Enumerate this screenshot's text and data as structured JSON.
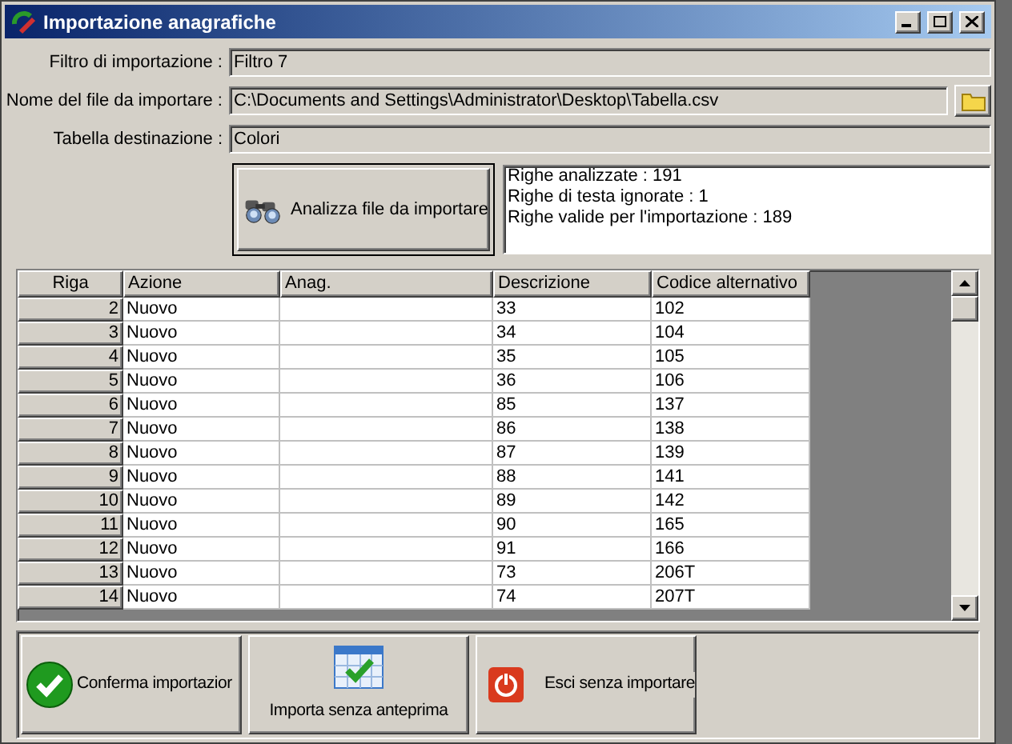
{
  "window": {
    "title": "Importazione anagrafiche"
  },
  "fields": [
    {
      "label": "Filtro di importazione :",
      "value": "Filtro 7",
      "kind": "text"
    },
    {
      "label": "Nome del file da importare :",
      "value": "C:\\Documents and Settings\\Administrator\\Desktop\\Tabella.csv",
      "kind": "file"
    },
    {
      "label": "Tabella destinazione :",
      "value": "Colori",
      "kind": "text"
    }
  ],
  "analyze_button": {
    "label": "Analizza file da importare"
  },
  "summary": [
    "Righe analizzate : 191",
    "Righe di testa ignorate : 1",
    "Righe valide per l'importazione : 189"
  ],
  "table": {
    "columns": [
      "Riga",
      "Azione",
      "Anag.",
      "Descrizione",
      "Codice alternativo"
    ],
    "rows": [
      [
        "2",
        "Nuovo",
        "",
        "33",
        "102"
      ],
      [
        "3",
        "Nuovo",
        "",
        "34",
        "104"
      ],
      [
        "4",
        "Nuovo",
        "",
        "35",
        "105"
      ],
      [
        "5",
        "Nuovo",
        "",
        "36",
        "106"
      ],
      [
        "6",
        "Nuovo",
        "",
        "85",
        "137"
      ],
      [
        "7",
        "Nuovo",
        "",
        "86",
        "138"
      ],
      [
        "8",
        "Nuovo",
        "",
        "87",
        "139"
      ],
      [
        "9",
        "Nuovo",
        "",
        "88",
        "141"
      ],
      [
        "10",
        "Nuovo",
        "",
        "89",
        "142"
      ],
      [
        "11",
        "Nuovo",
        "",
        "90",
        "165"
      ],
      [
        "12",
        "Nuovo",
        "",
        "91",
        "166"
      ],
      [
        "13",
        "Nuovo",
        "",
        "73",
        "206T"
      ],
      [
        "14",
        "Nuovo",
        "",
        "74",
        "207T"
      ]
    ]
  },
  "buttons": [
    {
      "label": "Conferma importazior",
      "kind": "confirm"
    },
    {
      "label": "Importa senza anteprima",
      "kind": "calendar"
    },
    {
      "label": "Esci senza importare",
      "kind": "exit"
    }
  ]
}
